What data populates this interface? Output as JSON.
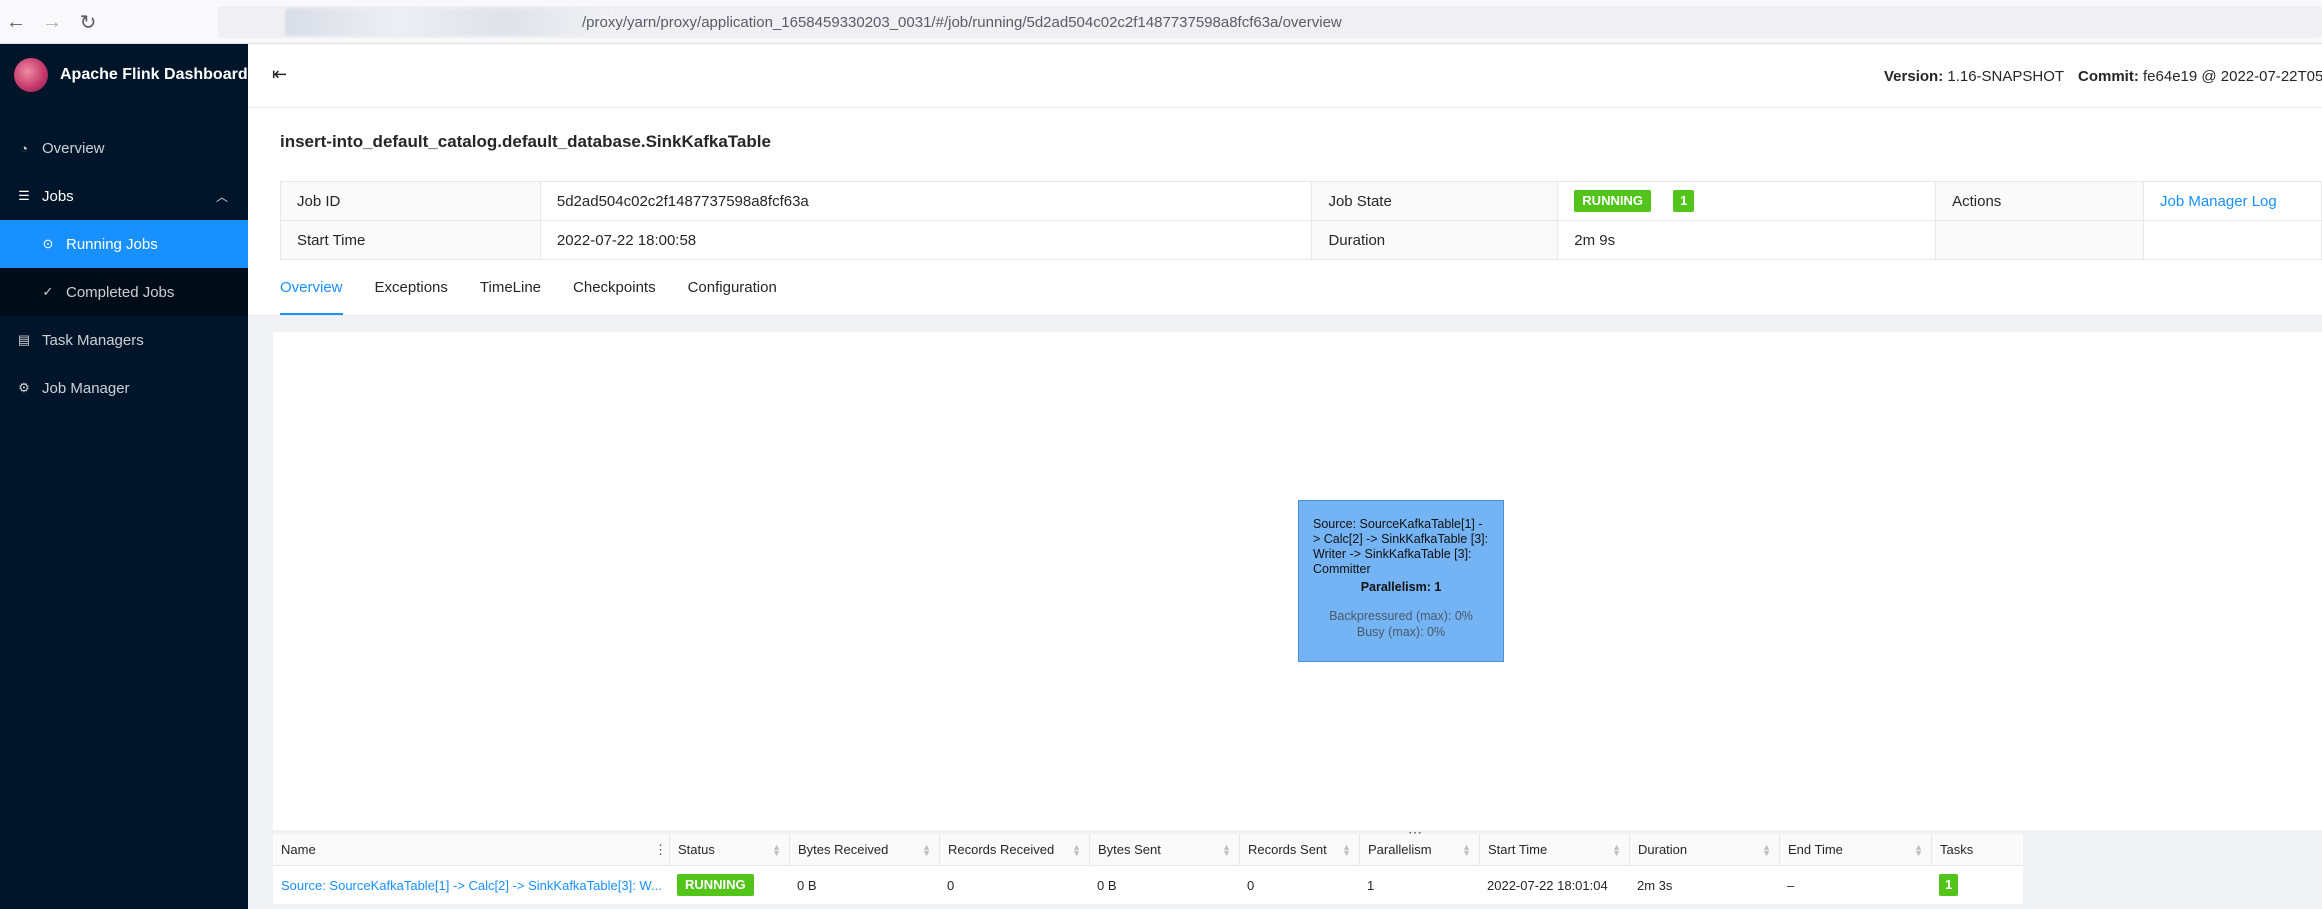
{
  "browser": {
    "url_text": "/proxy/yarn/proxy/application_1658459330203_0031/#/job/running/5d2ad504c02c2f1487737598a8fcf63a/overview"
  },
  "sidebar": {
    "app_title": "Apache Flink Dashboard",
    "items": [
      {
        "label": "Overview",
        "icon": "dashboard-icon"
      },
      {
        "label": "Jobs",
        "icon": "list-icon"
      },
      {
        "label": "Running Jobs",
        "icon": "play-circle-icon"
      },
      {
        "label": "Completed Jobs",
        "icon": "check-circle-icon"
      },
      {
        "label": "Task Managers",
        "icon": "schedule-icon"
      },
      {
        "label": "Job Manager",
        "icon": "build-icon"
      }
    ]
  },
  "header": {
    "version_label": "Version:",
    "version_value": "1.16-SNAPSHOT",
    "commit_label": "Commit:",
    "commit_value": "fe64e19 @ 2022-07-22T05"
  },
  "job": {
    "title": "insert-into_default_catalog.default_database.SinkKafkaTable",
    "id_label": "Job ID",
    "id_value": "5d2ad504c02c2f1487737598a8fcf63a",
    "state_label": "Job State",
    "state_value": "RUNNING",
    "state_count": "1",
    "actions_label": "Actions",
    "actions_link": "Job Manager Log",
    "start_label": "Start Time",
    "start_value": "2022-07-22 18:00:58",
    "duration_label": "Duration",
    "duration_value": "2m 9s"
  },
  "tabs": [
    "Overview",
    "Exceptions",
    "TimeLine",
    "Checkpoints",
    "Configuration"
  ],
  "graph": {
    "node_name": "Source: SourceKafkaTable[1] -> Calc[2] -> SinkKafkaTable [3]: Writer -> SinkKafkaTable [3]: Committer",
    "parallelism": "Parallelism: 1",
    "backpressured": "Backpressured (max): 0%",
    "busy": "Busy (max): 0%"
  },
  "vertices": {
    "columns": [
      "Name",
      "Status",
      "Bytes Received",
      "Records Received",
      "Bytes Sent",
      "Records Sent",
      "Parallelism",
      "Start Time",
      "Duration",
      "End Time",
      "Tasks"
    ],
    "rows": [
      {
        "name": "Source: SourceKafkaTable[1] -> Calc[2] -> SinkKafkaTable[3]: W...",
        "status": "RUNNING",
        "bytes_received": "0 B",
        "records_received": "0",
        "bytes_sent": "0 B",
        "records_sent": "0",
        "parallelism": "1",
        "start_time": "2022-07-22 18:01:04",
        "duration": "2m 3s",
        "end_time": "–",
        "tasks": "1"
      }
    ]
  }
}
